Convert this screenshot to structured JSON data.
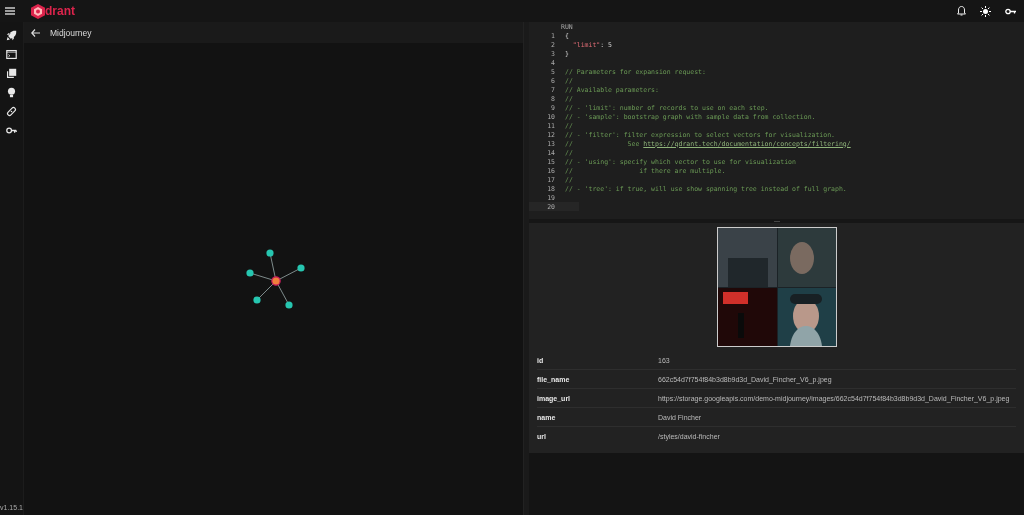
{
  "app": {
    "logo_text": "drant",
    "version": "v1.15.1"
  },
  "sidebar": {
    "items": [
      {
        "selected": false
      },
      {
        "selected": false
      },
      {
        "selected": false
      },
      {
        "selected": false
      },
      {
        "selected": false
      },
      {
        "selected": false
      }
    ]
  },
  "collection": {
    "title": "Midjourney"
  },
  "editor": {
    "run_label": "RUN",
    "lines": [
      {
        "number": "1",
        "tokens": [
          {
            "kind": "punct",
            "text": "{"
          }
        ]
      },
      {
        "number": "2",
        "tokens": [
          {
            "kind": "key",
            "text": "  \"limit\""
          },
          {
            "kind": "punct",
            "text": ": 5"
          }
        ]
      },
      {
        "number": "3",
        "tokens": [
          {
            "kind": "punct",
            "text": "}"
          }
        ]
      },
      {
        "number": "4"
      },
      {
        "number": "5",
        "tokens": [
          {
            "kind": "comment",
            "text": "// Parameters for expansion request:"
          }
        ]
      },
      {
        "number": "6",
        "tokens": [
          {
            "kind": "comment",
            "text": "//"
          }
        ]
      },
      {
        "number": "7",
        "tokens": [
          {
            "kind": "comment",
            "text": "// Available parameters:"
          }
        ]
      },
      {
        "number": "8",
        "tokens": [
          {
            "kind": "comment",
            "text": "//"
          }
        ]
      },
      {
        "number": "9",
        "tokens": [
          {
            "kind": "comment",
            "text": "// - 'limit': number of records to use on each step."
          }
        ]
      },
      {
        "number": "10",
        "tokens": [
          {
            "kind": "comment",
            "text": "// - 'sample': bootstrap graph with sample data from collection."
          }
        ]
      },
      {
        "number": "11",
        "tokens": [
          {
            "kind": "comment",
            "text": "//"
          }
        ]
      },
      {
        "number": "12",
        "tokens": [
          {
            "kind": "comment",
            "text": "// - 'filter': filter expression to select vectors for visualization."
          }
        ]
      },
      {
        "number": "13",
        "tokens": [
          {
            "kind": "comment",
            "text": "//              See "
          },
          {
            "kind": "link",
            "text": "https://qdrant.tech/documentation/concepts/filtering/"
          }
        ]
      },
      {
        "number": "14",
        "tokens": [
          {
            "kind": "comment",
            "text": "//"
          }
        ]
      },
      {
        "number": "15",
        "tokens": [
          {
            "kind": "comment",
            "text": "// - 'using': specify which vector to use for visualization"
          }
        ]
      },
      {
        "number": "16",
        "tokens": [
          {
            "kind": "comment",
            "text": "//                 if there are multiple."
          }
        ]
      },
      {
        "number": "17",
        "tokens": [
          {
            "kind": "comment",
            "text": "//"
          }
        ]
      },
      {
        "number": "18",
        "tokens": [
          {
            "kind": "comment",
            "text": "// - 'tree': if true, will use show spanning tree instead of full graph."
          }
        ]
      },
      {
        "number": "19"
      },
      {
        "number": "20",
        "selected": true
      }
    ]
  },
  "point": {
    "kind": "picture",
    "payload": [
      {
        "key": "id",
        "value": "163"
      },
      {
        "key": "file_name",
        "value": "662c54d7f754f84b3d8b9d3d_David_Fincher_V6_p.jpeg"
      },
      {
        "key": "image_url",
        "value": "https://storage.googleapis.com/demo-midjourney/images/662c54d7f754f84b3d8b9d3d_David_Fincher_V6_p.jpeg"
      },
      {
        "key": "name",
        "value": "David Fincher"
      },
      {
        "key": "url",
        "value": "/styles/david-fincher"
      }
    ]
  }
}
